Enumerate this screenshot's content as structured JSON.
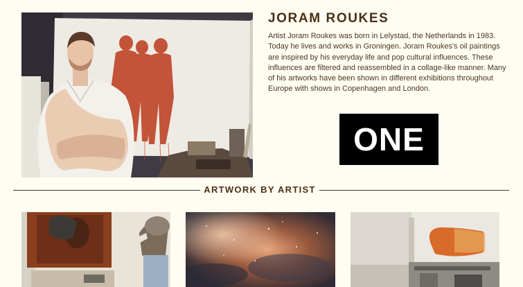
{
  "artist": {
    "name": "JORAM ROUKES",
    "bio": "Artist Joram Roukes was born in Lelystad, the Netherlands in 1983. Today he lives and works in Groningen. Joram Roukes's oil paintings are inspired by his everyday life and pop cultural influences. These influences are filtered and reassembled in a collage-like manner. Many of his artworks have been shown in different exhibitions throughout Europe with shows in Copenhagen and London.",
    "portrait_icon": "artist-photo"
  },
  "logo": {
    "text": "ONE",
    "background": "#000000",
    "color": "#ffffff"
  },
  "artwork_section": {
    "title": "ARTWORK BY ARTIST",
    "items": [
      {
        "icon": "artwork-thumbnail"
      },
      {
        "icon": "artwork-thumbnail"
      },
      {
        "icon": "artwork-thumbnail"
      }
    ]
  },
  "colors": {
    "background": "#fffdf1",
    "heading": "#4a2f16",
    "text": "#4a3422"
  }
}
